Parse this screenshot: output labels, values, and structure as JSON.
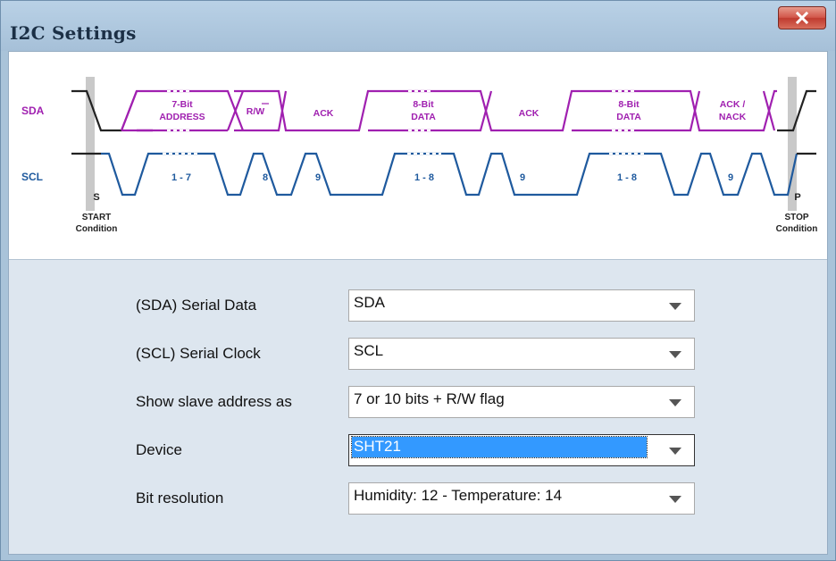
{
  "window": {
    "title": "I2C Settings",
    "close_icon": "close-icon"
  },
  "timing_diagram": {
    "signals": [
      "SDA",
      "SCL"
    ],
    "sda_fields": [
      {
        "line1": "7-Bit",
        "line2": "ADDRESS"
      },
      {
        "line1": "R/W",
        "line2": ""
      },
      {
        "line1": "ACK",
        "line2": ""
      },
      {
        "line1": "8-Bit",
        "line2": "DATA"
      },
      {
        "line1": "ACK",
        "line2": ""
      },
      {
        "line1": "8-Bit",
        "line2": "DATA"
      },
      {
        "line1": "ACK /",
        "line2": "NACK"
      }
    ],
    "scl_labels": [
      "1 - 7",
      "8",
      "9",
      "1 - 8",
      "9",
      "1 - 8",
      "9"
    ],
    "start_marker": "S",
    "stop_marker": "P",
    "start_caption": {
      "line1": "START",
      "line2": "Condition"
    },
    "stop_caption": {
      "line1": "STOP",
      "line2": "Condition"
    },
    "colors": {
      "sda": "#a020b0",
      "scl": "#1f5a9e",
      "marker": "#222222"
    }
  },
  "settings": [
    {
      "label": "(SDA) Serial Data",
      "value": "SDA"
    },
    {
      "label": "(SCL) Serial Clock",
      "value": "SCL"
    },
    {
      "label": "Show slave address as",
      "value": "7 or 10 bits + R/W flag"
    },
    {
      "label": "Device",
      "value": "SHT21",
      "selected": true
    },
    {
      "label": "Bit resolution",
      "value": "Humidity: 12 - Temperature: 14"
    }
  ]
}
